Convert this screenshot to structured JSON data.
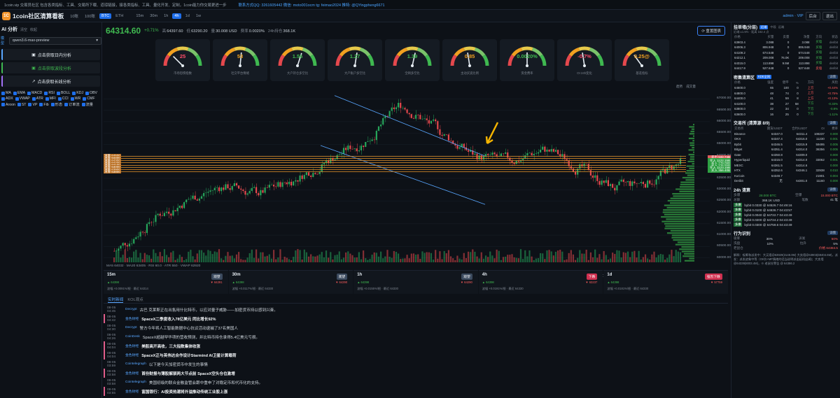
{
  "topbar": {
    "text_a": "1coin.vip 交易员社区 包含各类指标、工具、交易所下载、道琼链接，接各类指标、工具、量化开发、定制，1coin能力你交易更进一步",
    "text_b": "联系方式QQ: 3261605442 微信: moto001ocm tg: feimao2024 推特: @QYingpheng6671"
  },
  "header": {
    "logo": "1C",
    "title": "1coin社区清算看板",
    "markets": [
      "10账",
      "100账",
      "BTC",
      "ETH"
    ],
    "active_market": "BTC",
    "timeframes": [
      "15m",
      "30m",
      "1h",
      "4h",
      "1d",
      "1w"
    ],
    "active_tf": "4h",
    "user": "admin · VIP",
    "btn1": "后台",
    "btn2": "退出"
  },
  "left": {
    "title": "AI 分析",
    "tab1": "清空",
    "tab2": "收起",
    "model_label": "模型",
    "model": "qwen3.6-max-preview",
    "btn_intraday": "点击获取日内分析",
    "btn_swing": "点击获取波段分析",
    "btn_long": "点击获取长线分析",
    "indicators": [
      "MA",
      "EMA",
      "MACD",
      "RSI",
      "BOLL",
      "KDJ",
      "OBV",
      "ADX",
      "VWAP",
      "ATR",
      "MFI",
      "CCI",
      "WR",
      "CMF",
      "Aroon",
      "ST",
      "VP",
      "Fib",
      "形态",
      "订单流",
      "流量"
    ]
  },
  "ticker": {
    "price": "64314.60",
    "change": "+0.71%",
    "h_label": "高",
    "high": "64397.60",
    "l_label": "低",
    "low": "63290.20",
    "vol_label": "量",
    "volume": "30.008 USD",
    "rate_label": "费率",
    "rate": "0.0020%",
    "oi_label": "24h持仓",
    "oi": "368.1K",
    "reset": "重置图表"
  },
  "gauges": [
    {
      "value": "25",
      "label": "市场恐惧指数",
      "color": "#ff4d6a",
      "frac": 0.25
    },
    {
      "value": "53",
      "label": "社交平台情绪",
      "color": "#f0a020",
      "frac": 0.53
    },
    {
      "value": "1.56",
      "label": "大户持仓多空比",
      "color": "#3fb950",
      "frac": 0.6
    },
    {
      "value": "1.27",
      "label": "大户账户多空比",
      "color": "#3fb950",
      "frac": 0.55
    },
    {
      "value": "1.39",
      "label": "全网多空比",
      "color": "#3fb950",
      "frac": 0.57
    },
    {
      "value": "0.85",
      "label": "主动买卖比例",
      "color": "#f0a020",
      "frac": 0.45
    },
    {
      "value": "0.0020%",
      "label": "资金费率",
      "color": "#3fb950",
      "frac": 0.5
    },
    {
      "value": "-0.7%",
      "label": "OI 24h变化",
      "color": "#ff4d6a",
      "frac": 0.45
    },
    {
      "value": "0.25@",
      "label": "基差指标",
      "color": "#f0a020",
      "frac": 0.3
    }
  ],
  "chart_data": {
    "type": "candlestick",
    "ylim": [
      59800,
      67200
    ],
    "y_ticks": [
      "67000.00",
      "66500.00",
      "66000.00",
      "65500.00",
      "65000.00",
      "64500.00",
      "64000.00",
      "63500.00",
      "63000.00",
      "62500.00",
      "62000.00",
      "61500.00",
      "61000.00",
      "60500.00",
      "60000.00"
    ],
    "x_ticks": [
      "25日",
      "28日",
      "7月",
      "4日",
      "7日",
      "10日",
      "13日",
      "16日",
      "19日",
      "22日",
      "25日",
      "28日",
      "31日",
      "8月",
      "4日"
    ],
    "legend": [
      "趋势",
      "成交量"
    ],
    "liq_levels": [
      {
        "label": "清算 64500",
        "price": 64500
      },
      {
        "label": "清算 64400",
        "price": 64400
      },
      {
        "label": "清算 64300",
        "price": 64300
      },
      {
        "label": "清算 64200",
        "price": 64200
      },
      {
        "label": "清算 64100",
        "price": 64100
      },
      {
        "label": "清算 64000",
        "price": 64000
      },
      {
        "label": "清算 63900",
        "price": 63900
      },
      {
        "label": "清算 63800",
        "price": 63800
      }
    ],
    "price_labels": [
      {
        "text": "卖出 532.74B",
        "price": 64430,
        "color": "#e05d5d"
      },
      {
        "text": "64314.30",
        "price": 64314,
        "color": "#2ea043"
      },
      {
        "text": "买入 1122.15B",
        "price": 64260,
        "color": "#2ea043"
      },
      {
        "text": "买入 179.09B",
        "price": 64150,
        "color": "#2ea043"
      },
      {
        "text": "买入 126.55B",
        "price": 64050,
        "color": "#2ea043"
      },
      {
        "text": "买入 1123.15B",
        "price": 63950,
        "color": "#2ea043"
      },
      {
        "text": "买入 356.40B",
        "price": 63850,
        "color": "#2ea043"
      }
    ]
  },
  "indicator_line": "MA5 64032 · MA20 63405 · RSI 60.0 · ATR 550 · VWAP 62920",
  "tf_cards": [
    {
      "tf": "15m",
      "badge": "观望",
      "badge_color": "#3b4a5e",
      "sub": "▲ 64398",
      "sub2": "波幅 +0.0091%/根 · 最近 64314",
      "subr": "▼ 64291"
    },
    {
      "tf": "30m",
      "badge": "观望",
      "badge_color": "#3b4a5e",
      "sub": "▲ 64398",
      "sub2": "波幅 +0.0117%/根 · 最近 64330",
      "subr": "▼ 64290"
    },
    {
      "tf": "1h",
      "badge": "观望",
      "badge_color": "#3b4a5e",
      "sub": "▲ 64398",
      "sub2": "波幅 +0.0155%/根 · 最近 64330",
      "subr": "▼ 64290"
    },
    {
      "tf": "4h",
      "badge": "下跌",
      "badge_color": "#d03050",
      "sub": "▲ 64398",
      "sub2": "波幅 +0.0191%/根 · 最近 64330",
      "subr": "▼ 63237"
    },
    {
      "tf": "1d",
      "badge": "强烈下跌",
      "badge_color": "#d03050",
      "sub": "▲ 64398",
      "sub2": "波幅 +0.0181%/根 · 最近 64330",
      "subr": "▼ 57759"
    }
  ],
  "news_tabs": [
    "实时新闻",
    "KOL观点"
  ],
  "news": [
    {
      "time": "08-05 04:45",
      "src": "Decrypt",
      "text": "古巴 克莱斯正在出售用什比特币，以应对量子威胁——加密货币持以感到兴奋。",
      "hl": false
    },
    {
      "time": "08-05 04:42",
      "src": "金色财经",
      "text": "SpaceX二季度收入78亿美元 同比增长92%",
      "hl": true
    },
    {
      "time": "08-05 04:30",
      "src": "Decrypt",
      "text": "警方今年将人工智能数据中心抗议活动逮捕了37名美国人",
      "hl": false
    },
    {
      "time": "08-05 04:26",
      "src": "CoinDesk",
      "text": "SpaceX超越罕华项的营收预测，并比特币持仓录得5.4亿美元亏损。",
      "hl": false
    },
    {
      "time": "08-05 04:04",
      "src": "金色财经",
      "text": "美股高开高收，三大指数集体收涨",
      "hl": true
    },
    {
      "time": "08-05 04:04",
      "src": "金色财经",
      "text": "SpaceX正与英伟达合作设计Starmind AI卫星计算载荷",
      "hl": true
    },
    {
      "time": "08-05 03:59",
      "src": "Cointelegraph",
      "text": "以下是今天加密货币中发生的事情",
      "hl": false
    },
    {
      "time": "08-05 03:58",
      "src": "金色财经",
      "text": "首份财报与薄股解禁两大节点前 SpaceX空头仓位激增",
      "hl": true
    },
    {
      "time": "08-05 03:58",
      "src": "Cointelegraph",
      "text": "美国初级的联合金融监管会跟中重申了对稳定币和代币化的支持。",
      "hl": false
    },
    {
      "time": "08-05 03:55",
      "src": "金色财经",
      "text": "富国银行：AI投资热潮将外溢推动传统工业股上涨",
      "hl": true
    }
  ],
  "orderbook": {
    "title": "挂单墙(分层)",
    "tabs": [
      "近端",
      "中段",
      "远端"
    ],
    "sub": "近端 ±1.5% · 距离 162.4 点",
    "cols": [
      "价格",
      "买量",
      "卖量",
      "净量",
      "方向",
      "状态"
    ],
    "rows": [
      [
        "63903.4",
        "3.088",
        "0",
        "3.088",
        "买墙",
        "deribit"
      ],
      [
        "64006.3",
        "806.948",
        "0",
        "806.948",
        "买墙",
        "deribit"
      ],
      [
        "64109.2",
        "674.548",
        "0",
        "674.548",
        "买墙",
        "deribit"
      ],
      [
        "64212.1",
        "209.008",
        "76.0K",
        "209.008",
        "买墙",
        "deribit"
      ],
      [
        "64315.0",
        "113.898",
        "9.5M",
        "113.898",
        "买墙",
        "deribit"
      ],
      [
        "64417.9",
        "527.648",
        "0",
        "527.648",
        "卖墙",
        "deribit"
      ]
    ]
  },
  "liqzone": {
    "title": "密集清算区",
    "tag": "KDE全网",
    "cols": [
      "价格",
      "强度",
      "健平",
      "%",
      "方向",
      "风险"
    ],
    "rows": [
      [
        "64600.0",
        "65",
        "100",
        "0",
        "上方",
        "+0.44%"
      ],
      [
        "64800.0",
        "48",
        "74",
        "0",
        "上方",
        "+0.75%"
      ],
      [
        "64400.0",
        "41",
        "59",
        "8",
        "上方",
        "+0.13%"
      ],
      [
        "64100.0",
        "38",
        "27",
        "58",
        "下方",
        "-0.33%"
      ],
      [
        "63800.0",
        "22",
        "34",
        "0",
        "下方",
        "-0.8%"
      ],
      [
        "63600.0",
        "16",
        "25",
        "0",
        "下方",
        "-1.11%"
      ]
    ]
  },
  "exchanges": {
    "title": "交易所 (清算源 8/9)",
    "cols": [
      "交易所",
      "期货/USDT",
      "合约/USDT",
      "OI",
      "费率"
    ],
    "rows": [
      [
        "Binance",
        "64347.0",
        "64311.4",
        "108237",
        "0.000"
      ],
      [
        "OKX",
        "64347.4",
        "64316.0",
        "11230",
        "0.001"
      ],
      [
        "Bybit",
        "64346.5",
        "64315.9",
        "59495",
        "0.005"
      ],
      [
        "Bitget",
        "64351.4",
        "64314.0",
        "36356",
        "0.005"
      ],
      [
        "Gate",
        "64350.8",
        "64309.0",
        "",
        "0.000"
      ],
      [
        "Hyperliquid",
        "64315.0",
        "64314.0",
        "33062",
        "0.001"
      ],
      [
        "MEXC",
        "64361.5",
        "64314.6",
        "",
        "0.000"
      ],
      [
        "HTX",
        "64352.6",
        "64346.1",
        "32938",
        "0.010"
      ],
      [
        "KuCoin",
        "64349.7",
        "",
        "21901",
        "0.004"
      ],
      [
        "Deribit",
        "无",
        "64301.0",
        "11160",
        "0.000"
      ]
    ]
  },
  "liq24": {
    "title": "24h 清算",
    "long_label": "多爆",
    "long": "28.000 BTC",
    "short_label": "空爆",
    "short": "15.000 BTC",
    "total_label": "总额",
    "total": "368.1K USD",
    "cnt_label": "笔数",
    "cnt": "41 笔",
    "rows": [
      [
        "多爆",
        "bybit 0.0330 @ 64526.7 04:49:16"
      ],
      [
        "多爆",
        "bybit 0.0100 @ 64636.7 04:43:57"
      ],
      [
        "多爆",
        "bybit 0.0040 @ 64722.7 04:43:49"
      ],
      [
        "多爆",
        "bybit 0.0200 @ 64724.2 04:43:49"
      ],
      [
        "多爆",
        "bybit 0.0300 @ 64759.6 04:43:49"
      ]
    ]
  },
  "behavior": {
    "title": "行为识别",
    "r1": [
      "吸筹",
      "30%",
      "派发",
      "50%"
    ],
    "r2": [
      "洗盘",
      "10%",
      "拉升",
      "5%"
    ],
    "r3": [
      "老鼠仓",
      "",
      "",
      "价格 64384.5"
    ],
    "note": "解释：吸筹和派发中：大买墙@63929(3148.0M) 大卖墙@63903(69404.6M)，派发：派发迹象中等（OI/价+MF情绪的话当说明派出延机出调)；大卖墙@64339(8003.4M)，※ 老鼠仓警告 @ 64386.2"
  }
}
